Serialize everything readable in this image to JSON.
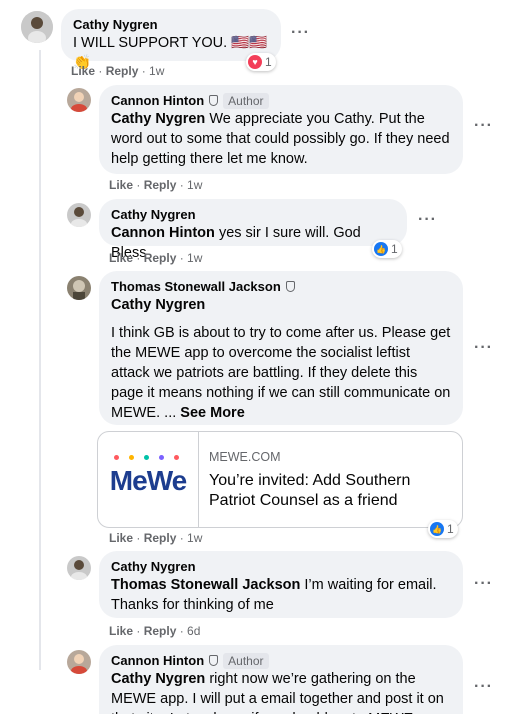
{
  "comments": [
    {
      "author": "Cathy Nygren",
      "text": "I WILL SUPPORT YOU. 🇺🇸🇺🇸👏",
      "like": "Like",
      "reply": "Reply",
      "time": "1w",
      "reaction_count": "1",
      "reaction_type": "love"
    },
    {
      "author": "Cannon Hinton",
      "badge": "Author",
      "tag": "Cathy Nygren",
      "text": "We appreciate you Cathy. Put the word out to some that could possibly go. If they need help getting there let me know.",
      "like": "Like",
      "reply": "Reply",
      "time": "1w"
    },
    {
      "author": "Cathy Nygren",
      "tag": "Cannon Hinton",
      "text": "yes sir I sure will. God Bless",
      "like": "Like",
      "reply": "Reply",
      "time": "1w",
      "reaction_count": "1",
      "reaction_type": "like"
    },
    {
      "author": "Thomas Stonewall Jackson",
      "tag": "Cathy Nygren",
      "text": "I think GB is about to try to come after us. Please get the MEWE app to overcome the socialist leftist attack we patriots are battling. If they delete this page it means nothing if we can still communicate on MEWE. ...",
      "see_more": "See More",
      "like": "Like",
      "reply": "Reply",
      "time": "1w",
      "reaction_count": "1",
      "reaction_type": "like",
      "link": {
        "domain": "MEWE.COM",
        "title": "You’re invited: Add Southern Patriot Counsel as a friend",
        "logo_text": "MeWe"
      }
    },
    {
      "author": "Cathy Nygren",
      "tag": "Thomas Stonewall Jackson",
      "text": "I’m waiting for email. Thanks for thinking of me",
      "like": "Like",
      "reply": "Reply",
      "time": "6d"
    },
    {
      "author": "Cannon Hinton",
      "badge": "Author",
      "tag": "Cathy Nygren",
      "text": "right now we’re gathering on the MEWE app. I will put a email together and post it on that site. Let us know if we should go to MEWE"
    }
  ],
  "more_options": "···"
}
